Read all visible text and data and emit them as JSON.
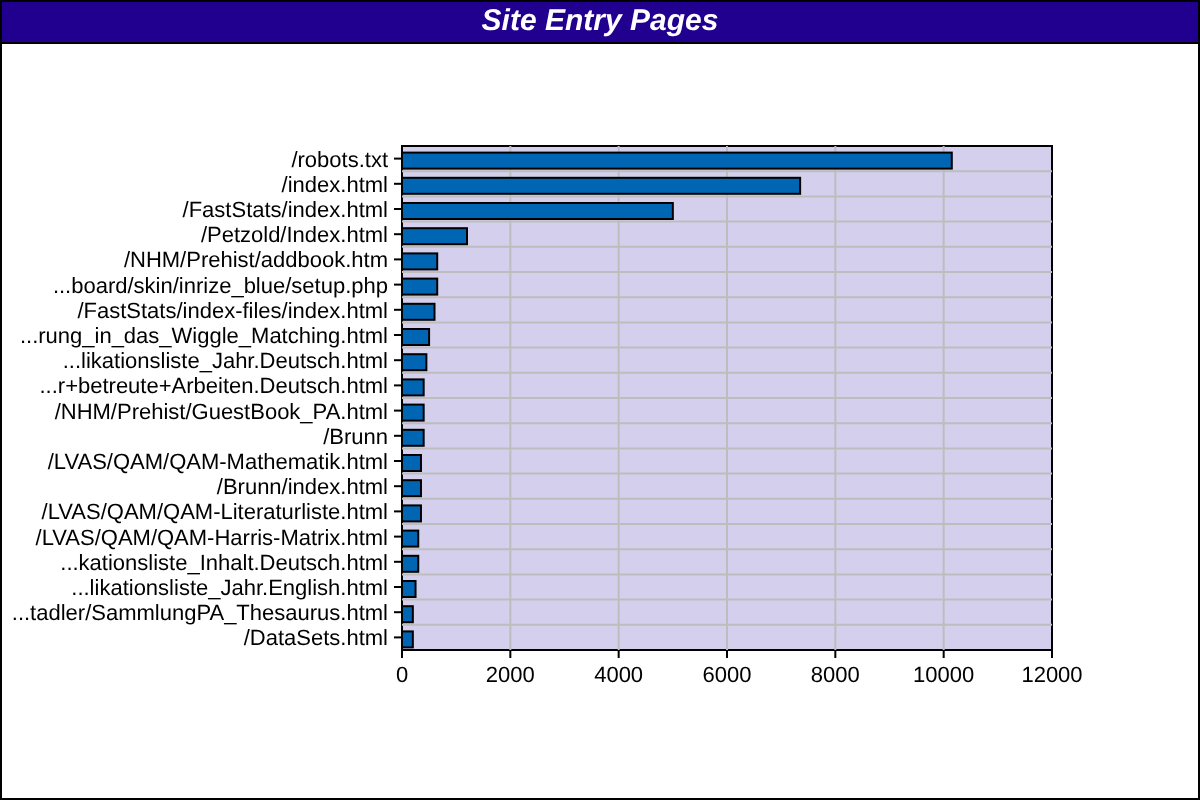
{
  "window": {
    "title": "Site Entry Pages"
  },
  "chart": {
    "chart_data": {
      "type": "bar",
      "orientation": "horizontal",
      "grid": true,
      "categories": [
        "/robots.txt",
        "/index.html",
        "/FastStats/index.html",
        "/Petzold/Index.html",
        "/NHM/Prehist/addbook.htm",
        "...board/skin/inrize_blue/setup.php",
        "/FastStats/index-files/index.html",
        "...rung_in_das_Wiggle_Matching.html",
        "...likationsliste_Jahr.Deutsch.html",
        "...r+betreute+Arbeiten.Deutsch.html",
        "/NHM/Prehist/GuestBook_PA.html",
        "/Brunn",
        "/LVAS/QAM/QAM-Mathematik.html",
        "/Brunn/index.html",
        "/LVAS/QAM/QAM-Literaturliste.html",
        "/LVAS/QAM/QAM-Harris-Matrix.html",
        "...kationsliste_Inhalt.Deutsch.html",
        "...likationsliste_Jahr.English.html",
        "...tadler/SammlungPA_Thesaurus.html",
        "/DataSets.html"
      ],
      "series": [
        {
          "color": "#0066b3",
          "values": [
            10150,
            7350,
            5000,
            1200,
            650,
            650,
            600,
            500,
            450,
            400,
            400,
            400,
            350,
            350,
            350,
            300,
            300,
            250,
            200,
            200
          ]
        }
      ],
      "xlim": [
        0,
        12000
      ],
      "xticks": [
        0,
        2000,
        4000,
        6000,
        8000,
        10000,
        12000
      ]
    }
  }
}
